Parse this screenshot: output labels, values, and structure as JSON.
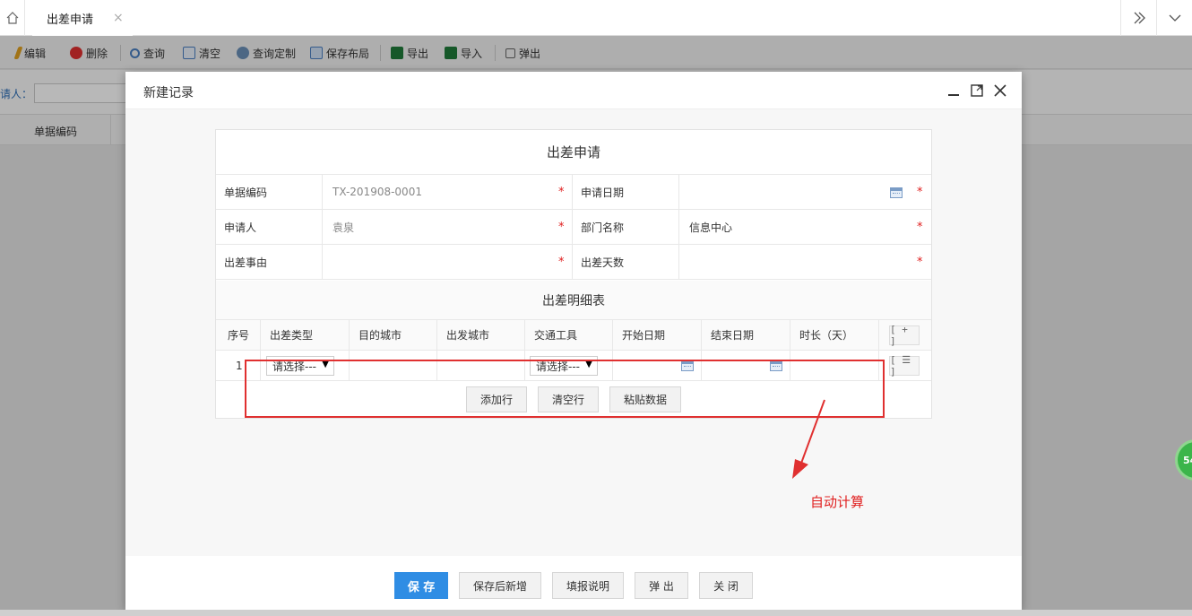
{
  "tabbar": {
    "active_tab": "出差申请",
    "close_glyph": "×"
  },
  "toolbar": {
    "items": [
      {
        "label": "编辑",
        "icon": "pencil-icon",
        "color": "#e0a020"
      },
      {
        "label": "删除",
        "icon": "delete-icon",
        "color": "#e03030"
      },
      {
        "label": "查询",
        "icon": "search-icon",
        "color": "#4a7fc1"
      },
      {
        "label": "清空",
        "icon": "clear-icon",
        "color": "#4a7fc1"
      },
      {
        "label": "查询定制",
        "icon": "gear-icon",
        "color": "#6a8fb8"
      },
      {
        "label": "保存布局",
        "icon": "layout-icon",
        "color": "#4a7fc1"
      },
      {
        "label": "导出",
        "icon": "excel-export-icon",
        "color": "#1f7a3a"
      },
      {
        "label": "导入",
        "icon": "excel-import-icon",
        "color": "#1f7a3a"
      },
      {
        "label": "弹出",
        "icon": "popout-icon",
        "color": "#666666"
      }
    ]
  },
  "filter": {
    "label": "请人："
  },
  "grid": {
    "column": "单据编码"
  },
  "side_badge": "54",
  "dialog": {
    "title": "新建记录",
    "form_title": "出差申请",
    "fields": {
      "doc_code_label": "单据编码",
      "doc_code_value": "TX-201908-0001",
      "apply_date_label": "申请日期",
      "applicant_label": "申请人",
      "applicant_value": "袁泉",
      "dept_label": "部门名称",
      "dept_value": "信息中心",
      "reason_label": "出差事由",
      "days_label": "出差天数"
    },
    "required_mark": "*",
    "detail": {
      "title": "出差明细表",
      "columns": [
        "序号",
        "出差类型",
        "目的城市",
        "出发城市",
        "交通工具",
        "开始日期",
        "结束日期",
        "时长（天）"
      ],
      "rows": [
        {
          "index": "1",
          "trip_type": "请选择---",
          "transport": "请选择---"
        }
      ],
      "add_row_glyph": "[ + ]",
      "row_menu_glyph": "[ ☰ ]",
      "buttons": {
        "add_row": "添加行",
        "clear_rows": "清空行",
        "paste_data": "粘贴数据"
      }
    },
    "annotation": "自动计算",
    "footer": {
      "save": "保 存",
      "save_new": "保存后新增",
      "instructions": "填报说明",
      "popup": "弹 出",
      "close": "关 闭"
    }
  },
  "colors": {
    "primary": "#2f8de4",
    "required": "#e02020",
    "annotation": "#e03030"
  }
}
